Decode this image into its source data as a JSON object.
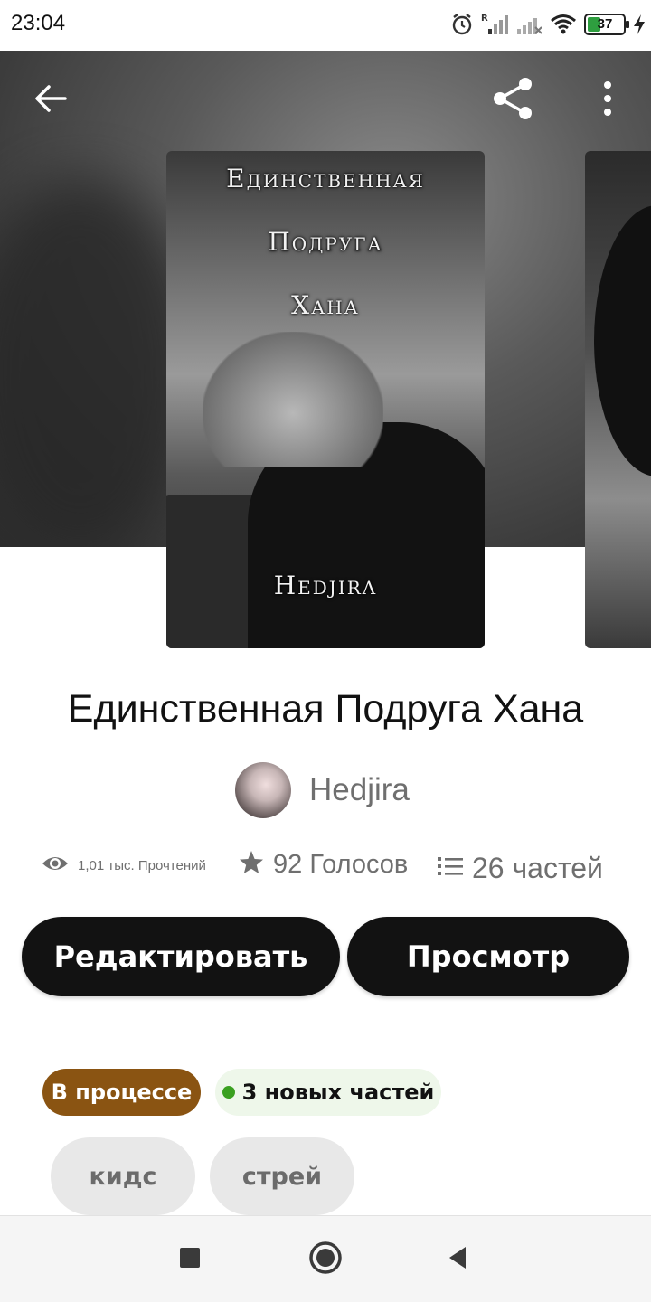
{
  "status_bar": {
    "time": "23:04",
    "battery_level": "37",
    "icons": [
      "alarm-icon",
      "signal-roaming-icon",
      "signal-no-service-icon",
      "wifi-icon",
      "battery-icon",
      "charging-bolt-icon"
    ]
  },
  "toolbar": {
    "icons": [
      "arrow-left-icon",
      "share-icon",
      "more-vertical-icon"
    ]
  },
  "cover": {
    "title_line1": "Единственная",
    "title_line2": "Подруга",
    "title_line3": "Хана",
    "author_line": "Hedjira"
  },
  "story": {
    "title": "Единственная Подруга Хана",
    "author": "Hedjira"
  },
  "stats": {
    "reads": "1,01 тыс. Прочтений",
    "votes": "92 Голосов",
    "parts": "26 частей",
    "icons": [
      "eye-icon",
      "star-icon",
      "list-icon"
    ]
  },
  "actions": {
    "edit_label": "Редактировать",
    "view_label": "Просмотр"
  },
  "chips": {
    "status": "В процессе",
    "new_parts": "3 новых частей"
  },
  "tags": [
    "кидс",
    "стрей"
  ],
  "colors": {
    "status_chip": "#8a5412",
    "new_parts_dot": "#3aa020",
    "button_bg": "#121212",
    "battery_fill": "#2e9e3f"
  },
  "nav_bar": {
    "icons": [
      "recent-apps-icon",
      "home-icon",
      "back-triangle-icon"
    ]
  }
}
